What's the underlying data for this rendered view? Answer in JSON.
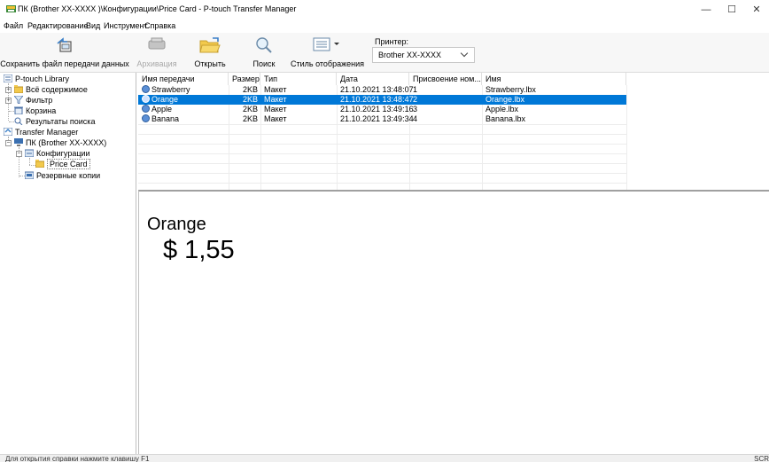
{
  "window": {
    "title": "ПК (Brother XX-XXXX )\\Конфигурации\\Price Card - P-touch Transfer Manager",
    "minimize": "—",
    "maximize": "☐",
    "close": "✕"
  },
  "menu": [
    "Файл",
    "Редактирование",
    "Вид",
    "Инструмент",
    "Справка"
  ],
  "toolbar": {
    "save_label": "Сохранить файл передачи данных",
    "archive_label": "Архивация",
    "open_label": "Открыть",
    "search_label": "Поиск",
    "view_style_label": "Стиль отображения",
    "printer_label": "Принтер:",
    "printer_value": "Brother XX-XXXX"
  },
  "tree": {
    "library": "P-touch Library",
    "all_content": "Всё содержимое",
    "filter": "Фильтр",
    "trash": "Корзина",
    "search_results": "Результаты поиска",
    "transfer_manager": "Transfer Manager",
    "pc": "ПК (Brother XX-XXXX)",
    "configurations": "Конфигурации",
    "price_card": "Price Card",
    "backups": "Резервные копии"
  },
  "table": {
    "columns": [
      "Имя передачи",
      "Размер",
      "Тип",
      "Дата",
      "Присвоение ном...",
      "Имя"
    ],
    "rows": [
      {
        "name": "Strawberry",
        "size": "2KB",
        "type": "Макет",
        "date": "21.10.2021 13:48:07",
        "key": "1",
        "file": "Strawberry.lbx"
      },
      {
        "name": "Orange",
        "size": "2KB",
        "type": "Макет",
        "date": "21.10.2021 13:48:47",
        "key": "2",
        "file": "Orange.lbx"
      },
      {
        "name": "Apple",
        "size": "2KB",
        "type": "Макет",
        "date": "21.10.2021 13:49:16",
        "key": "3",
        "file": "Apple.lbx"
      },
      {
        "name": "Banana",
        "size": "2KB",
        "type": "Макет",
        "date": "21.10.2021 13:49:34",
        "key": "4",
        "file": "Banana.lbx"
      }
    ],
    "selected_index": 1
  },
  "preview": {
    "name": "Orange",
    "price": "$ 1,55"
  },
  "status": {
    "text": "Для открытия справки нажмите клавишу F1",
    "scr": "SCR"
  },
  "colors": {
    "selection": "#0078d7",
    "toolbar_bg": "#f7f7f7"
  }
}
